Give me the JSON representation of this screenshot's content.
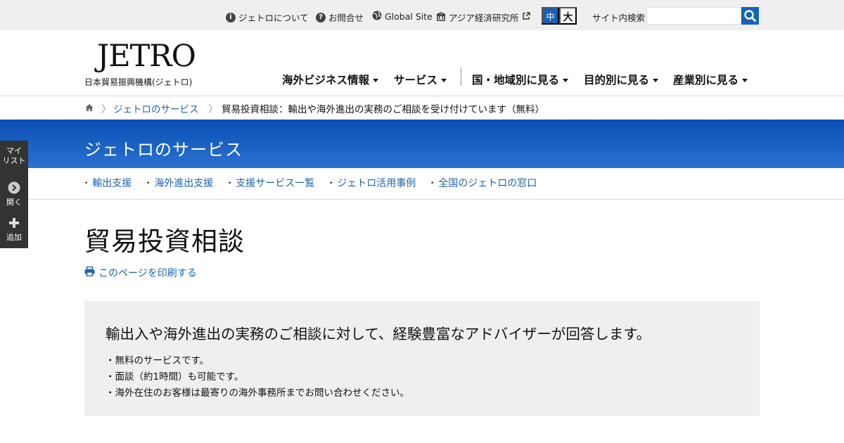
{
  "utility": {
    "about": "ジェトロについて",
    "contact": "お問合せ",
    "global": "Global Site",
    "ide": "アジア経済研究所",
    "size_mid": "中",
    "size_big": "大",
    "search_label": "サイト内検索",
    "search_value": ""
  },
  "header": {
    "logo": "JETRO",
    "logo_sub": "日本貿易振興機構(ジェトロ)",
    "nav": [
      "海外ビジネス情報",
      "サービス",
      "国・地域別に見る",
      "目的別に見る",
      "産業別に見る"
    ]
  },
  "breadcrumb": {
    "link": "ジェトロのサービス",
    "current": "貿易投資相談：輸出や海外進出の実務のご相談を受け付けています（無料）"
  },
  "banner": {
    "title": "ジェトロのサービス"
  },
  "subnav": [
    "輸出支援",
    "海外進出支援",
    "支援サービス一覧",
    "ジェトロ活用事例",
    "全国のジェトロの窓口"
  ],
  "main": {
    "title": "貿易投資相談",
    "print": "このページを印刷する",
    "lead": "輸出入や海外進出の実務のご相談に対して、経験豊富なアドバイザーが回答します。",
    "bullets": [
      "無料のサービスです。",
      "面談（約1時間）も可能です。",
      "海外在住のお客様は最寄りの海外事務所までお問い合わせください。"
    ]
  },
  "side": {
    "mylist_1": "マイ",
    "mylist_2": "リスト",
    "open": "開く",
    "add": "追加"
  },
  "colors": {
    "accent": "#1564b8",
    "banner_top": "#0a4db4",
    "box_bg": "#efefef"
  },
  "icons": [
    "info-icon",
    "question-icon",
    "globe-icon",
    "building-icon",
    "external-link-icon",
    "search-icon",
    "home-icon",
    "printer-icon",
    "chevron-right-icon",
    "plus-icon"
  ]
}
